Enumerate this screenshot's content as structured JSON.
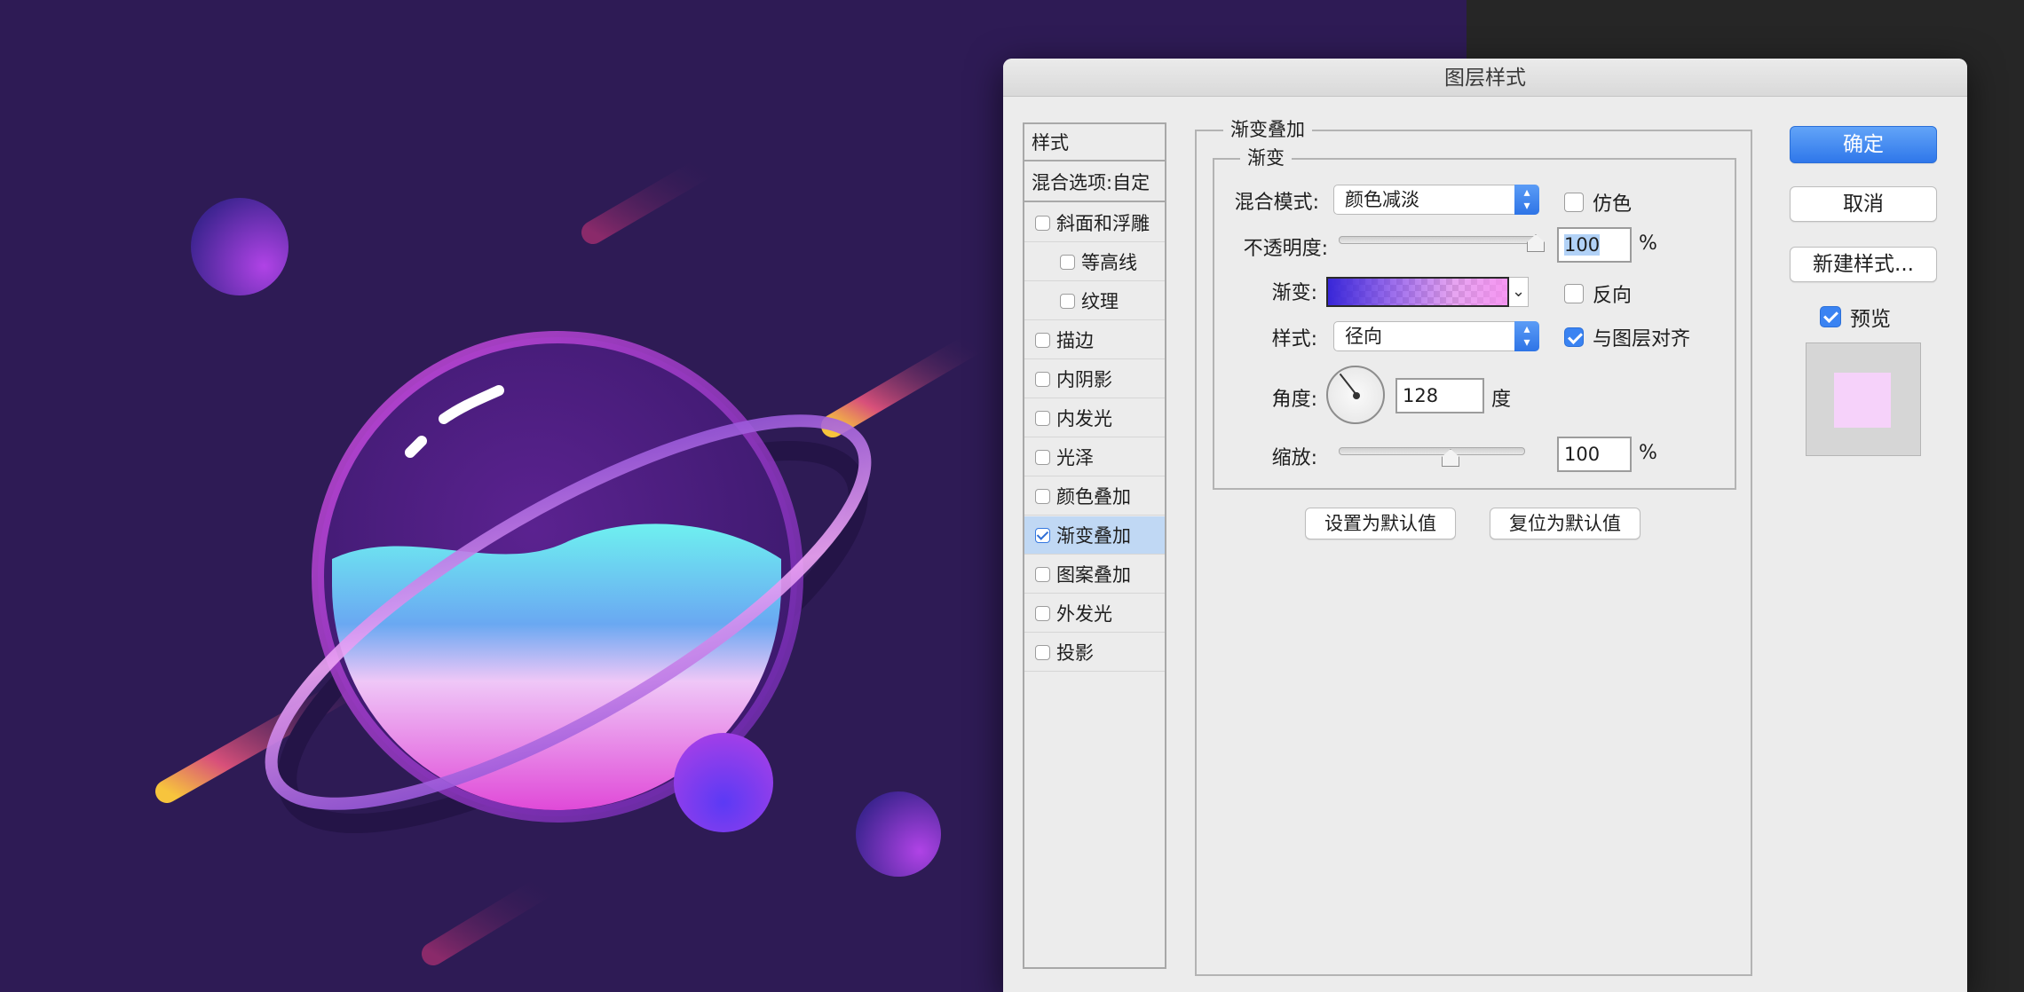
{
  "dialog": {
    "title": "图层样式",
    "styles_header": "样式",
    "blend_options": "混合选项:自定",
    "style_items": [
      {
        "label": "斜面和浮雕",
        "checked": false,
        "indent": false,
        "selected": false
      },
      {
        "label": "等高线",
        "checked": false,
        "indent": true,
        "selected": false
      },
      {
        "label": "纹理",
        "checked": false,
        "indent": true,
        "selected": false
      },
      {
        "label": "描边",
        "checked": false,
        "indent": false,
        "selected": false
      },
      {
        "label": "内阴影",
        "checked": false,
        "indent": false,
        "selected": false
      },
      {
        "label": "内发光",
        "checked": false,
        "indent": false,
        "selected": false
      },
      {
        "label": "光泽",
        "checked": false,
        "indent": false,
        "selected": false
      },
      {
        "label": "颜色叠加",
        "checked": false,
        "indent": false,
        "selected": false
      },
      {
        "label": "渐变叠加",
        "checked": true,
        "indent": false,
        "selected": true
      },
      {
        "label": "图案叠加",
        "checked": false,
        "indent": false,
        "selected": false
      },
      {
        "label": "外发光",
        "checked": false,
        "indent": false,
        "selected": false
      },
      {
        "label": "投影",
        "checked": false,
        "indent": false,
        "selected": false
      }
    ],
    "section_title": "渐变叠加",
    "subsection_title": "渐变",
    "blend_mode_label": "混合模式:",
    "blend_mode_value": "颜色减淡",
    "dither_label": "仿色",
    "dither_checked": false,
    "opacity_label": "不透明度:",
    "opacity_value": "100",
    "opacity_fraction": 1.0,
    "percent": "%",
    "gradient_label": "渐变:",
    "gradient_colors": [
      "#3826d8",
      "#f58cf0"
    ],
    "reverse_label": "反向",
    "reverse_checked": false,
    "style_label": "样式:",
    "style_value": "径向",
    "align_label": "与图层对齐",
    "align_checked": true,
    "angle_label": "角度:",
    "angle_value": "128",
    "degree_unit": "度",
    "scale_label": "缩放:",
    "scale_value": "100",
    "scale_fraction": 0.58,
    "make_default": "设置为默认值",
    "reset_default": "复位为默认值",
    "ok": "确定",
    "cancel": "取消",
    "new_style": "新建样式...",
    "preview_label": "预览",
    "preview_checked": true,
    "preview_color": "#f6d2fa"
  },
  "colors": {
    "canvas_bg": "#2e1b55",
    "accent_blue": "#2f77ea"
  }
}
